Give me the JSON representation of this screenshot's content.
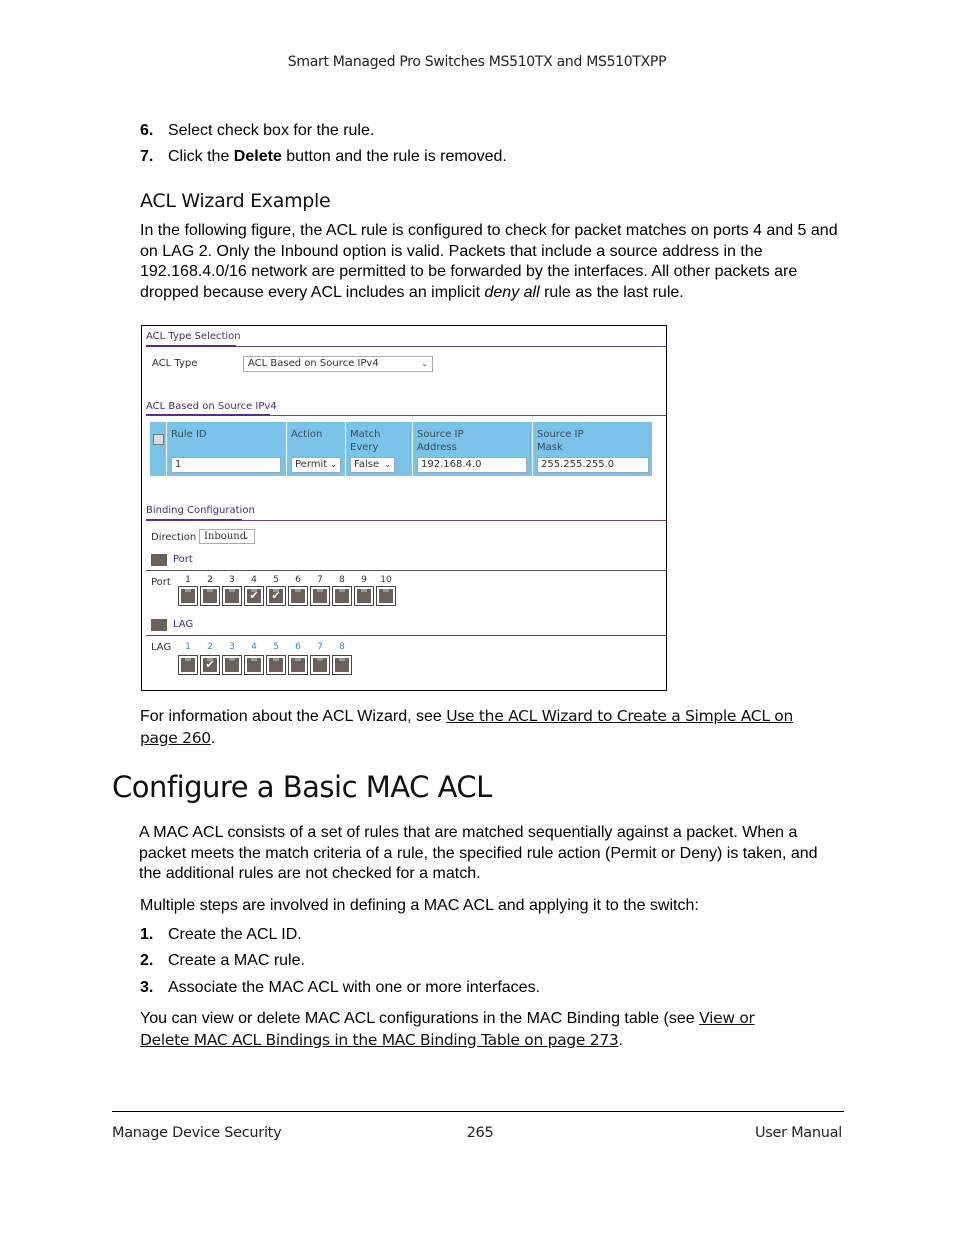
{
  "header": {
    "title": "Smart Managed Pro Switches MS510TX and MS510TXPP"
  },
  "steps_top": [
    {
      "num": "6.",
      "text": "Select check box for the rule."
    },
    {
      "num": "7.",
      "pre": "Click the ",
      "bold": "Delete",
      "post": " button and the rule is removed."
    }
  ],
  "subsection": {
    "title": "ACL Wizard Example",
    "para_pre": "In the following figure, the ACL rule is configured to check for packet matches on ports 4 and 5 and on LAG 2. Only the Inbound option is valid. Packets that include a source address in the 192.168.4.0/16 network are permitted to be forwarded by the interfaces. All other packets are dropped because every ACL includes an implicit ",
    "para_italic": "deny all",
    "para_post": " rule as the last rule."
  },
  "figure": {
    "acl_type_section": "ACL Type Selection",
    "acl_type_label": "ACL Type",
    "acl_type_value": "ACL Based on Source IPv4",
    "rule_section": "ACL Based on Source IPv4",
    "columns": [
      "Rule ID",
      "Action",
      "Match Every",
      "Source IP\nAddress",
      "Source IP\nMask"
    ],
    "col_src_ip_1": "Source IP",
    "col_src_ip_2": "Address",
    "col_src_mask_1": "Source IP",
    "col_src_mask_2": "Mask",
    "row": {
      "rule_id": "1",
      "action": "Permit",
      "match_every": "False",
      "source_ip": "192.168.4.0",
      "source_mask": "255.255.255.0"
    },
    "binding_section": "Binding Configuration",
    "direction_label": "Direction",
    "direction_value": "Inbound",
    "port_group_label": "Port",
    "port_row_label": "Port",
    "ports": [
      {
        "n": "1",
        "checked": false
      },
      {
        "n": "2",
        "checked": false
      },
      {
        "n": "3",
        "checked": false
      },
      {
        "n": "4",
        "checked": true
      },
      {
        "n": "5",
        "checked": true
      },
      {
        "n": "6",
        "checked": false
      },
      {
        "n": "7",
        "checked": false
      },
      {
        "n": "8",
        "checked": false
      },
      {
        "n": "9",
        "checked": false
      },
      {
        "n": "10",
        "checked": false
      }
    ],
    "lag_group_label": "LAG",
    "lag_row_label": "LAG",
    "lags": [
      {
        "n": "1",
        "checked": false
      },
      {
        "n": "2",
        "checked": true
      },
      {
        "n": "3",
        "checked": false
      },
      {
        "n": "4",
        "checked": false
      },
      {
        "n": "5",
        "checked": false
      },
      {
        "n": "6",
        "checked": false
      },
      {
        "n": "7",
        "checked": false
      },
      {
        "n": "8",
        "checked": false
      }
    ],
    "check_glyph": "✔"
  },
  "wizard_ref": {
    "pre": "For information about the ACL Wizard, see ",
    "link1": "Use the ACL Wizard to Create a Simple ACL on ",
    "link2": "page 260",
    "post": "."
  },
  "section": {
    "title": "Configure a Basic MAC ACL",
    "para1": "A MAC ACL consists of a set of rules that are matched sequentially against a packet. When a packet meets the match criteria of a rule, the specified rule action (Permit or Deny) is taken, and the additional rules are not checked for a match.",
    "para2": "Multiple steps are involved in defining a MAC ACL and applying it to the switch:",
    "steps": [
      {
        "num": "1.",
        "text": "Create the ACL ID."
      },
      {
        "num": "2.",
        "text": "Create a MAC rule."
      },
      {
        "num": "3.",
        "text": "Associate the MAC ACL with one or more interfaces."
      }
    ],
    "para3_pre": "You can view or delete MAC ACL configurations in the MAC Binding table (see ",
    "para3_link1": "View or ",
    "para3_link2": "Delete MAC ACL Bindings in the MAC Binding Table on page 273",
    "para3_post": "."
  },
  "footer": {
    "left": "Manage Device Security",
    "center": "265",
    "right": "User Manual"
  }
}
